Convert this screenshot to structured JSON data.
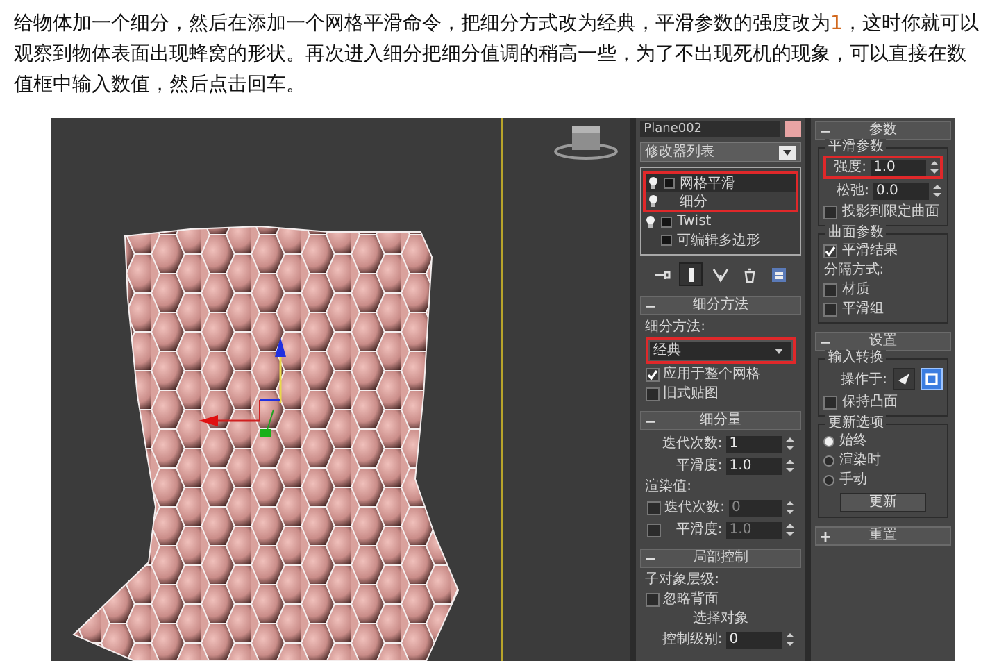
{
  "paragraph": {
    "segments": [
      {
        "text": "给物体加一个细分，然后在添加一个网格平滑命令，把细分方式改为经典，平滑参数的强度改为",
        "highlighted": false
      },
      {
        "text": "1",
        "highlighted": true
      },
      {
        "text": "，这时你就可以观察到物体表面出现蜂窝的形状。再次进入细分把细分值调的稍高一些，为了不出现死机的现象，可以直接在数值框中输入数值，然后点击回车。",
        "highlighted": false
      }
    ]
  },
  "modifier_panel": {
    "object_name": "Plane002",
    "modifier_list": "修改器列表",
    "stack": [
      {
        "label": "网格平滑",
        "toggle": true,
        "box": true,
        "selected": true,
        "outlined": true
      },
      {
        "label": "细分",
        "toggle": true,
        "box": false,
        "selected": false,
        "outlined": true
      },
      {
        "label": "Twist",
        "toggle": true,
        "box": true,
        "selected": false,
        "outlined": false
      },
      {
        "label": "可编辑多边形",
        "toggle": false,
        "box": true,
        "selected": false,
        "outlined": false
      }
    ],
    "stack_tools": [
      {
        "selected": false
      },
      {
        "selected": true
      },
      {
        "selected": false
      },
      {
        "selected": false
      },
      {
        "selected": false
      }
    ],
    "rollouts": [
      {
        "title": "细分方法",
        "expanded": true,
        "groups": [
          {
            "rows": [
              {
                "kind": "label",
                "text": "细分方法:"
              },
              {
                "kind": "dropdown",
                "value": "经典",
                "outlined": true
              },
              {
                "kind": "checkbox",
                "label": "应用于整个网格",
                "checked": true
              },
              {
                "kind": "checkbox",
                "label": "旧式贴图",
                "checked": false
              }
            ]
          }
        ]
      },
      {
        "title": "细分量",
        "expanded": true,
        "groups": [
          {
            "rows": [
              {
                "kind": "spinner",
                "label": "迭代次数:",
                "value": "1",
                "disabled": false,
                "outlined": false
              },
              {
                "kind": "spinner",
                "label": "平滑度:",
                "value": "1.0",
                "disabled": false,
                "outlined": false
              },
              {
                "kind": "label",
                "text": "渲染值:"
              },
              {
                "kind": "check_spinner",
                "checked": false,
                "label": "迭代次数:",
                "value": "0",
                "disabled": true,
                "outlined": false
              },
              {
                "kind": "check_spinner",
                "checked": false,
                "label": "平滑度:",
                "value": "1.0",
                "disabled": true,
                "outlined": false
              }
            ]
          }
        ]
      },
      {
        "title": "局部控制",
        "expanded": true,
        "groups": [
          {
            "rows": [
              {
                "kind": "label",
                "text": "子对象层级:"
              },
              {
                "kind": "checkbox",
                "label": "忽略背面",
                "checked": false
              },
              {
                "kind": "caption",
                "text": "选择对象"
              },
              {
                "kind": "spinner",
                "label": "控制级别:",
                "value": "0",
                "disabled": false,
                "outlined": false
              }
            ]
          }
        ]
      }
    ]
  },
  "parameters_panel": {
    "rollouts": [
      {
        "title": "参数",
        "expanded": true,
        "groups": [
          {
            "title": "平滑参数",
            "rows": [
              {
                "kind": "spinner",
                "label": "强度:",
                "value": "1.0",
                "disabled": false,
                "outlined": true
              },
              {
                "kind": "spinner",
                "label": "松弛:",
                "value": "0.0",
                "disabled": false,
                "outlined": false
              },
              {
                "kind": "checkbox",
                "label": "投影到限定曲面",
                "checked": false
              }
            ]
          },
          {
            "title": "曲面参数",
            "rows": [
              {
                "kind": "checkbox",
                "label": "平滑结果",
                "checked": true
              },
              {
                "kind": "label",
                "text": "分隔方式:"
              },
              {
                "kind": "checkbox",
                "label": "材质",
                "checked": false
              },
              {
                "kind": "checkbox",
                "label": "平滑组",
                "checked": false
              }
            ]
          }
        ]
      },
      {
        "title": "设置",
        "expanded": true,
        "groups": [
          {
            "title": "输入转换",
            "rows": [
              {
                "kind": "operate_on",
                "label": "操作于:",
                "buttons": [
                  {
                    "selected": false
                  },
                  {
                    "selected": true
                  }
                ]
              },
              {
                "kind": "checkbox",
                "label": "保持凸面",
                "checked": false
              }
            ]
          },
          {
            "title": "更新选项",
            "rows": [
              {
                "kind": "radio",
                "label": "始终",
                "selected": true
              },
              {
                "kind": "radio",
                "label": "渲染时",
                "selected": false
              },
              {
                "kind": "radio",
                "label": "手动",
                "selected": false
              },
              {
                "kind": "button",
                "label": "更新"
              }
            ]
          }
        ]
      },
      {
        "title": "重置",
        "expanded": false
      }
    ]
  }
}
